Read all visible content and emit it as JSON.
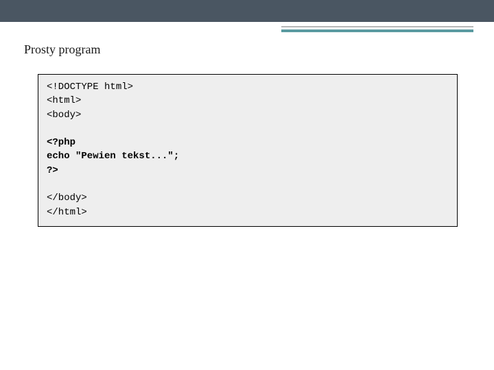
{
  "slide": {
    "title": "Prosty program"
  },
  "code": {
    "lines": [
      {
        "text": "<!DOCTYPE html>",
        "bold": false
      },
      {
        "text": "<html>",
        "bold": false
      },
      {
        "text": "<body>",
        "bold": false
      },
      {
        "text": "",
        "bold": false
      },
      {
        "text": "<?php",
        "bold": true
      },
      {
        "text": "echo \"Pewien tekst...\";",
        "bold": true
      },
      {
        "text": "?>",
        "bold": true
      },
      {
        "text": "",
        "bold": false
      },
      {
        "text": "</body>",
        "bold": false
      },
      {
        "text": "</html>",
        "bold": false
      }
    ]
  }
}
